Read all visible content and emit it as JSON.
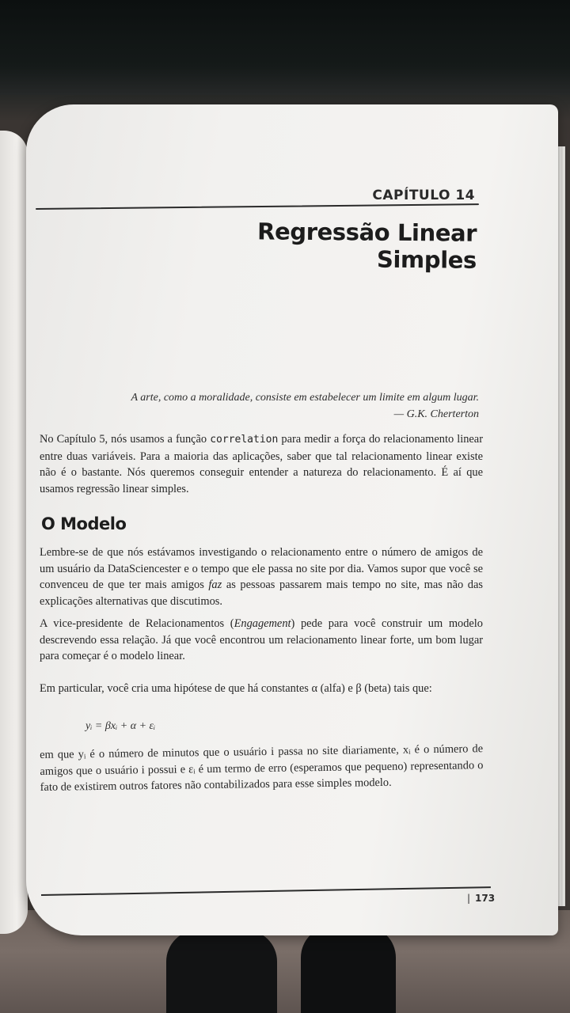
{
  "chapter": {
    "label": "CAPÍTULO 14",
    "title": "Regressão Linear Simples"
  },
  "epigraph": {
    "quote": "A arte, como a moralidade, consiste em estabelecer um limite em algum lugar.",
    "author": "— G.K. Cherterton"
  },
  "intro": {
    "p1_start": "No Capítulo 5, nós usamos a função ",
    "p1_code": "correlation",
    "p1_end": " para medir a força do relacionamento linear entre duas variáveis. Para a maioria das aplicações, saber que tal relacionamento linear existe não é o bastante. Nós queremos conseguir entender a natureza do relacionamento. É aí que usamos regressão linear simples."
  },
  "section": {
    "title": "O Modelo",
    "p1_start": "Lembre-se de que nós estávamos investigando o relacionamento entre o número de amigos de um usuário da DataSciencester e o tempo que ele passa no site por dia. Vamos supor que você se convenceu de que ter mais amigos ",
    "p1_em": "faz",
    "p1_end": " as pessoas passarem mais tempo no site, mas não das explicações alternativas que discutimos.",
    "p2_start": "A vice-presidente de Relacionamentos (",
    "p2_em": "Engagement",
    "p2_end": ") pede para você construir um modelo descrevendo essa relação. Já que você encontrou um relacionamento linear forte, um bom lugar para começar é o modelo linear.",
    "p3": "Em particular, você cria uma hipótese de que há constantes α (alfa) e β (beta) tais que:",
    "formula": "yᵢ = βxᵢ + α + εᵢ",
    "p4": "em que yᵢ é o número de minutos que o usuário i passa no site diariamente, xᵢ é o número de amigos que o usuário i possui e εᵢ é um termo de erro (esperamos que pequeno) representando o fato de existirem outros fatores não contabilizados para esse simples modelo."
  },
  "footer": {
    "page_number": "173"
  }
}
